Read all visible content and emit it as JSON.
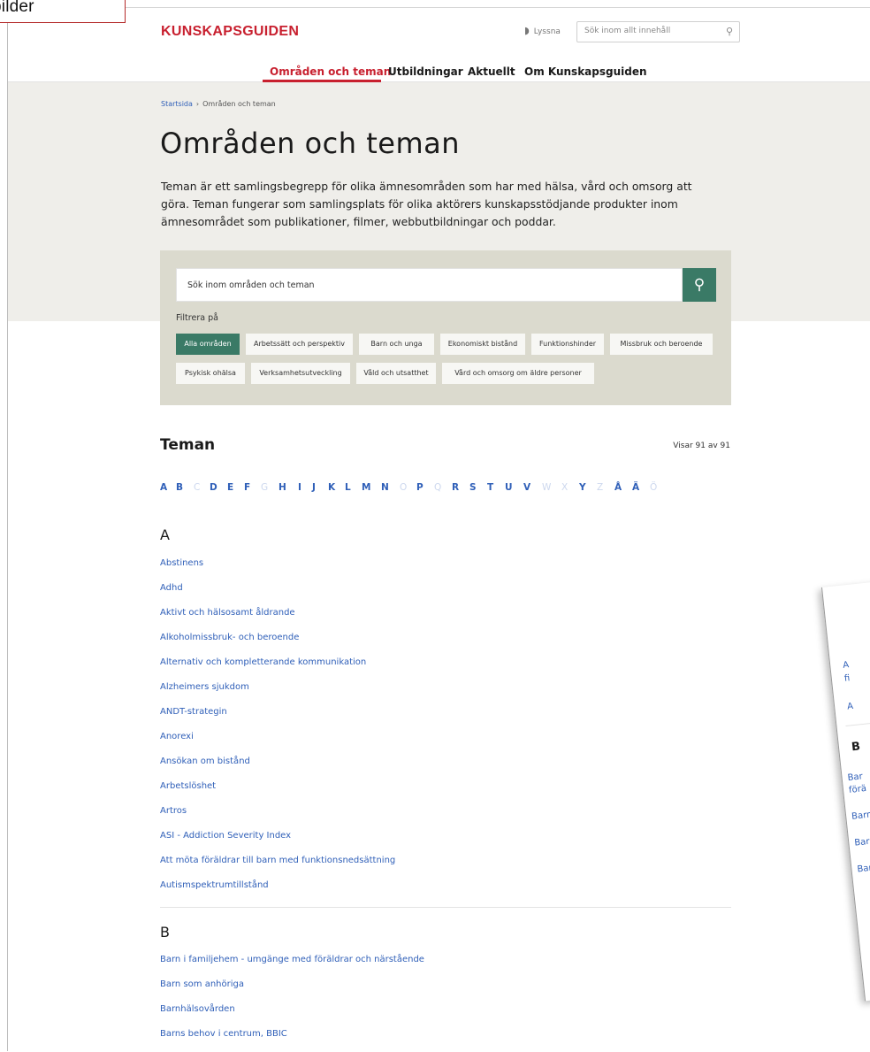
{
  "annotation": {
    "text": "bilder"
  },
  "header": {
    "logo": "KUNSKAPSGUIDEN",
    "listen_label": "Lyssna",
    "search_placeholder": "Sök inom allt innehåll",
    "nav": [
      {
        "label": "Områden och teman",
        "active": true
      },
      {
        "label": "Utbildningar"
      },
      {
        "label": "Aktuellt"
      },
      {
        "label": "Om Kunskapsguiden"
      }
    ]
  },
  "breadcrumb": {
    "home": "Startsida",
    "separator": "›",
    "current": "Områden och teman"
  },
  "page": {
    "title": "Områden och teman",
    "intro": "Teman är ett samlingsbegrepp för olika ämnesområden som har med hälsa, vård och omsorg att göra. Teman fungerar som samlingsplats för olika aktörers kunskapsstödjande produkter inom ämnesområdet som publikationer, filmer, webbutbildningar och poddar."
  },
  "filter_panel": {
    "search_placeholder": "Sök inom områden och teman",
    "filter_label": "Filtrera på",
    "chips": [
      {
        "label": "Alla områden",
        "active": true
      },
      {
        "label": "Arbetssätt och perspektiv"
      },
      {
        "label": "Barn och unga"
      },
      {
        "label": "Ekonomiskt bistånd"
      },
      {
        "label": "Funktionshinder"
      },
      {
        "label": "Missbruk och beroende"
      },
      {
        "label": "Psykisk ohälsa"
      },
      {
        "label": "Verksamhetsutveckling"
      },
      {
        "label": "Våld och utsatthet"
      },
      {
        "label": "Vård och omsorg om äldre personer"
      }
    ]
  },
  "themes": {
    "heading": "Teman",
    "count": "Visar 91 av 91",
    "alphabet": [
      {
        "letter": "A"
      },
      {
        "letter": "B"
      },
      {
        "letter": "C",
        "disabled": true
      },
      {
        "letter": "D"
      },
      {
        "letter": "E"
      },
      {
        "letter": "F"
      },
      {
        "letter": "G",
        "disabled": true
      },
      {
        "letter": "H"
      },
      {
        "letter": "I"
      },
      {
        "letter": "J"
      },
      {
        "letter": "K"
      },
      {
        "letter": "L"
      },
      {
        "letter": "M"
      },
      {
        "letter": "N"
      },
      {
        "letter": "O",
        "disabled": true
      },
      {
        "letter": "P"
      },
      {
        "letter": "Q",
        "disabled": true
      },
      {
        "letter": "R"
      },
      {
        "letter": "S"
      },
      {
        "letter": "T"
      },
      {
        "letter": "U"
      },
      {
        "letter": "V"
      },
      {
        "letter": "W",
        "disabled": true
      },
      {
        "letter": "X",
        "disabled": true
      },
      {
        "letter": "Y"
      },
      {
        "letter": "Z",
        "disabled": true
      },
      {
        "letter": "Å"
      },
      {
        "letter": "Ä"
      },
      {
        "letter": "Ö",
        "disabled": true
      }
    ],
    "groups": [
      {
        "letter": "A",
        "items": [
          "Abstinens",
          "Adhd",
          "Aktivt och hälsosamt åldrande",
          "Alkoholmissbruk- och beroende",
          "Alternativ och kompletterande kommunikation",
          "Alzheimers sjukdom",
          "ANDT-strategin",
          "Anorexi",
          "Ansökan om bistånd",
          "Arbetslöshet",
          "Artros",
          "ASI - Addiction Severity Index",
          "Att möta föräldrar till barn med funktionsnedsättning",
          "Autismspektrumtillstånd"
        ]
      },
      {
        "letter": "B",
        "items": [
          "Barn i familjehem - umgänge med föräldrar och närstående",
          "Barn som anhöriga",
          "Barnhälsovården",
          "Barns behov i centrum, BBIC"
        ]
      }
    ]
  },
  "overlay_fragment": {
    "lines": [
      "A",
      "fi",
      "A",
      "B",
      "Bar",
      "förä",
      "Barn",
      "Barn",
      "Barns"
    ]
  }
}
